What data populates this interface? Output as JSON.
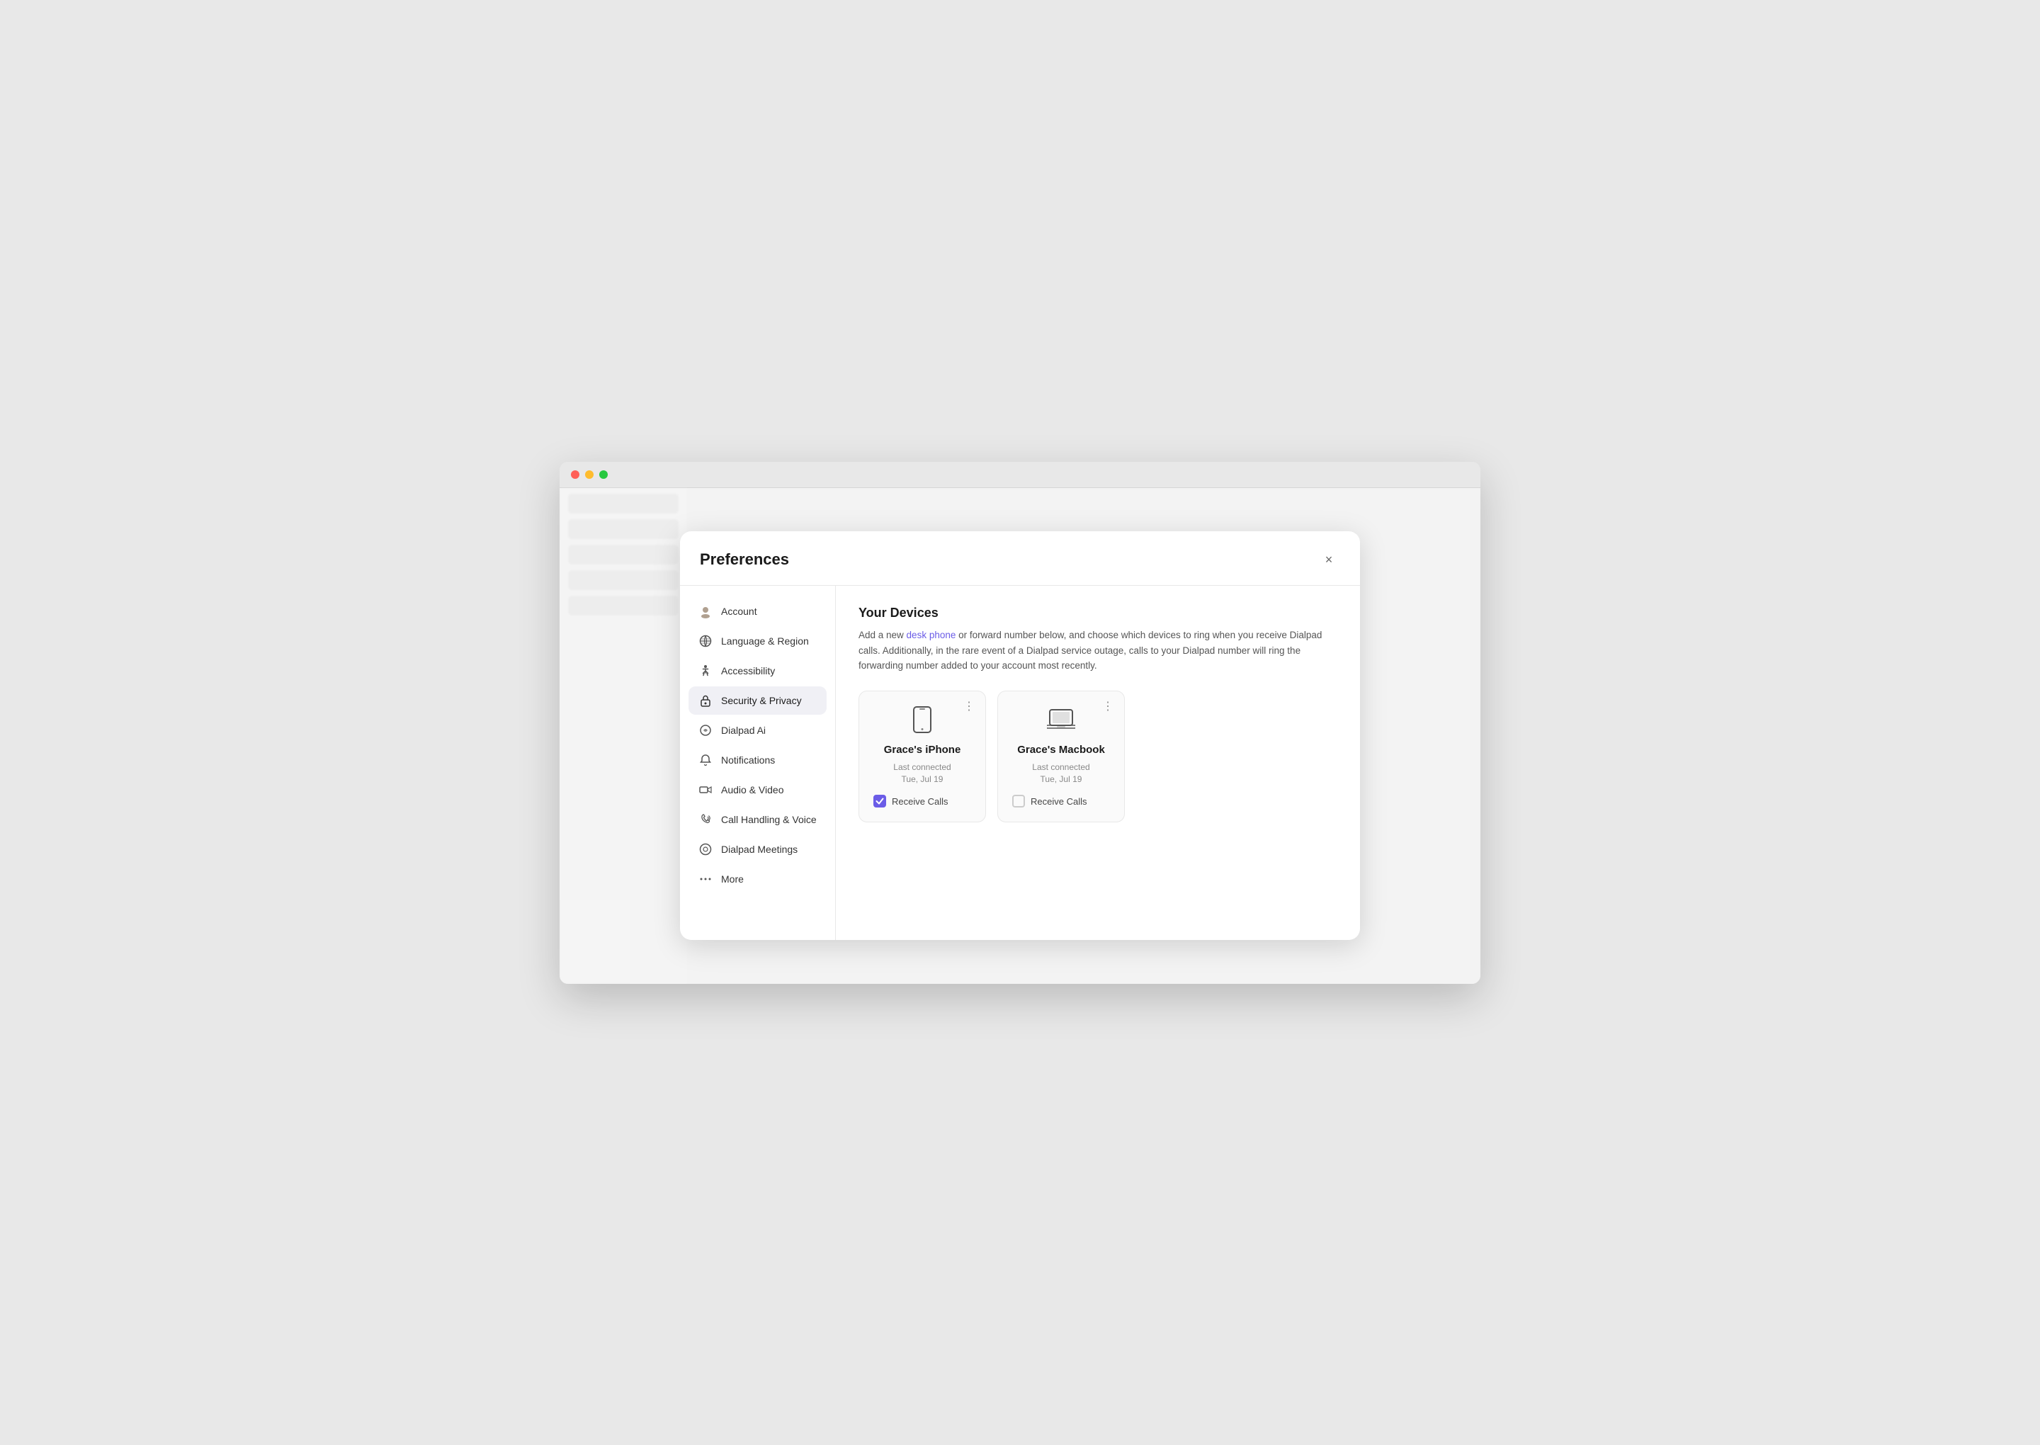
{
  "modal": {
    "title": "Preferences",
    "close_label": "×"
  },
  "nav": {
    "items": [
      {
        "id": "account",
        "label": "Account",
        "icon": "avatar",
        "active": false
      },
      {
        "id": "language-region",
        "label": "Language & Region",
        "icon": "language",
        "active": false
      },
      {
        "id": "accessibility",
        "label": "Accessibility",
        "icon": "accessibility",
        "active": false
      },
      {
        "id": "security-privacy",
        "label": "Security & Privacy",
        "icon": "lock",
        "active": true
      },
      {
        "id": "dialpad-ai",
        "label": "Dialpad Ai",
        "icon": "ai",
        "active": false
      },
      {
        "id": "notifications",
        "label": "Notifications",
        "icon": "bell",
        "active": false
      },
      {
        "id": "audio-video",
        "label": "Audio & Video",
        "icon": "camera",
        "active": false
      },
      {
        "id": "call-handling-voice",
        "label": "Call Handling & Voice",
        "icon": "phone",
        "active": false
      },
      {
        "id": "dialpad-meetings",
        "label": "Dialpad Meetings",
        "icon": "meetings",
        "active": false
      },
      {
        "id": "more",
        "label": "More",
        "icon": "more",
        "active": false
      }
    ]
  },
  "main": {
    "section_title": "Your Devices",
    "description_pre": "Add a new ",
    "description_link": "desk phone",
    "description_post": " or forward number below, and choose which devices to ring when you receive Dialpad calls. Additionally, in the rare event of a Dialpad service outage, calls to your Dialpad number will ring the forwarding number added to your account most recently.",
    "devices": [
      {
        "name": "Grace's iPhone",
        "icon": "mobile",
        "last_connected_label": "Last connected",
        "last_connected_date": "Tue, Jul 19",
        "receive_calls_label": "Receive Calls",
        "receive_calls_checked": true,
        "menu_dots": "⋮"
      },
      {
        "name": "Grace's Macbook",
        "icon": "laptop",
        "last_connected_label": "Last connected",
        "last_connected_date": "Tue, Jul 19",
        "receive_calls_label": "Receive Calls",
        "receive_calls_checked": false,
        "menu_dots": "⋮"
      }
    ]
  },
  "colors": {
    "accent": "#6b5ce7",
    "active_bg": "#f0f0f5",
    "checked_bg": "#6b5ce7"
  }
}
